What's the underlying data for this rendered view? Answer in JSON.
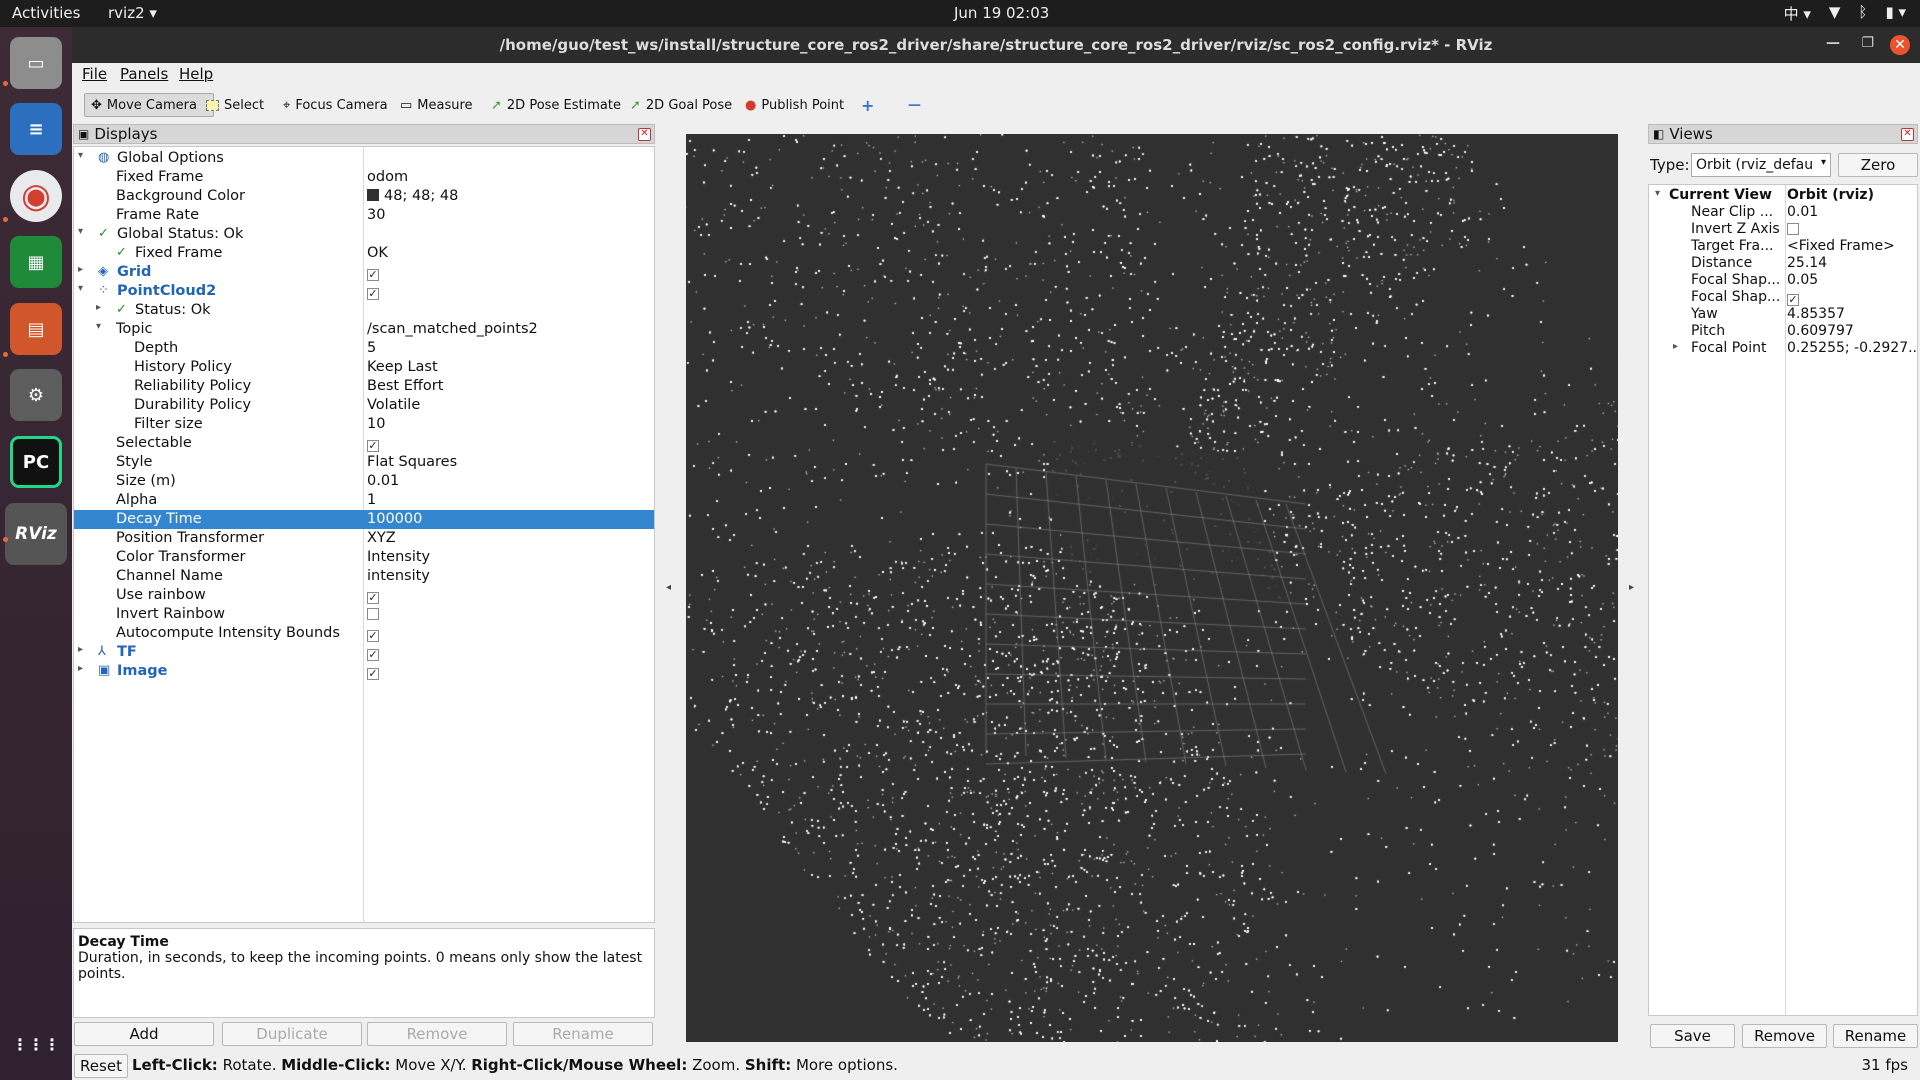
{
  "topbar": {
    "activities": "Activities",
    "app": "rviz2 ▾",
    "clock": "Jun 19  02:03",
    "lang": "中 ▾",
    "tray": [
      "▼",
      "ᛒ",
      "▮ ▾"
    ]
  },
  "dock": [
    {
      "name": "files-icon",
      "bg": "#8d8d8d",
      "glyph": "▭"
    },
    {
      "name": "writer-icon",
      "bg": "#2c6fbf",
      "glyph": "≡"
    },
    {
      "name": "chrome-icon",
      "bg": "#e8eaed",
      "glyph": "◉"
    },
    {
      "name": "calc-icon",
      "bg": "#1f8b3a",
      "glyph": "▦"
    },
    {
      "name": "impress-icon",
      "bg": "#d2562c",
      "glyph": "▤"
    },
    {
      "name": "settings-icon",
      "bg": "#5d5d5d",
      "glyph": "⚙"
    },
    {
      "name": "pycharm-icon",
      "bg": "#21d789",
      "glyph": "PC"
    },
    {
      "name": "rviz-icon",
      "bg": "#4a4a4a",
      "glyph": "RViz"
    },
    {
      "name": "apps-grid-icon",
      "bg": "transparent",
      "glyph": "⋮⋮⋮"
    }
  ],
  "window": {
    "title": "/home/guo/test_ws/install/structure_core_ros2_driver/share/structure_core_ros2_driver/rviz/sc_ros2_config.rviz* - RViz"
  },
  "menu": [
    "File",
    "Panels",
    "Help"
  ],
  "toolbar": [
    "Move Camera",
    "Select",
    "Focus Camera",
    "Measure",
    "2D Pose Estimate",
    "2D Goal Pose",
    "Publish Point",
    "+",
    "—"
  ],
  "displays": {
    "title": "Displays",
    "rows": [
      {
        "k": "Global Options",
        "v": "",
        "ind": 1,
        "arrow": "▾",
        "icon": "◍",
        "cls": ""
      },
      {
        "k": "Fixed Frame",
        "v": "odom",
        "ind": 2,
        "cls": ""
      },
      {
        "k": "Background Color",
        "v": "48; 48; 48",
        "ind": 2,
        "swatch": "#303030",
        "cls": ""
      },
      {
        "k": "Frame Rate",
        "v": "30",
        "ind": 2,
        "cls": ""
      },
      {
        "k": "Global Status: Ok",
        "v": "",
        "ind": 1,
        "arrow": "▾",
        "icon": "✓",
        "cls": "ok-icon"
      },
      {
        "k": "Fixed Frame",
        "v": "OK",
        "ind": 2,
        "icon": "✓",
        "cls": "ok-icon"
      },
      {
        "k": "Grid",
        "v": "",
        "ind": 1,
        "arrow": "▸",
        "icon": "◈",
        "cls": "blue",
        "check": true
      },
      {
        "k": "PointCloud2",
        "v": "",
        "ind": 1,
        "arrow": "▾",
        "icon": "⁘",
        "cls": "blue",
        "check": true
      },
      {
        "k": "Status: Ok",
        "v": "",
        "ind": 2,
        "arrow": "▸",
        "icon": "✓",
        "cls": "ok-icon"
      },
      {
        "k": "Topic",
        "v": "/scan_matched_points2",
        "ind": 2,
        "arrow": "▾",
        "cls": ""
      },
      {
        "k": "Depth",
        "v": "5",
        "ind": 3,
        "cls": ""
      },
      {
        "k": "History Policy",
        "v": "Keep Last",
        "ind": 3,
        "cls": ""
      },
      {
        "k": "Reliability Policy",
        "v": "Best Effort",
        "ind": 3,
        "cls": ""
      },
      {
        "k": "Durability Policy",
        "v": "Volatile",
        "ind": 3,
        "cls": ""
      },
      {
        "k": "Filter size",
        "v": "10",
        "ind": 3,
        "cls": ""
      },
      {
        "k": "Selectable",
        "v": "",
        "ind": 2,
        "check": true,
        "cls": ""
      },
      {
        "k": "Style",
        "v": "Flat Squares",
        "ind": 2,
        "cls": ""
      },
      {
        "k": "Size (m)",
        "v": "0.01",
        "ind": 2,
        "cls": ""
      },
      {
        "k": "Alpha",
        "v": "1",
        "ind": 2,
        "cls": ""
      },
      {
        "k": "Decay Time",
        "v": "100000",
        "ind": 2,
        "cls": "sel"
      },
      {
        "k": "Position Transformer",
        "v": "XYZ",
        "ind": 2,
        "cls": ""
      },
      {
        "k": "Color Transformer",
        "v": "Intensity",
        "ind": 2,
        "cls": ""
      },
      {
        "k": "Channel Name",
        "v": "intensity",
        "ind": 2,
        "cls": ""
      },
      {
        "k": "Use rainbow",
        "v": "",
        "ind": 2,
        "check": true,
        "cls": ""
      },
      {
        "k": "Invert Rainbow",
        "v": "",
        "ind": 2,
        "check": false,
        "cls": ""
      },
      {
        "k": "Autocompute Intensity Bounds",
        "v": "",
        "ind": 2,
        "check": true,
        "cls": ""
      },
      {
        "k": "TF",
        "v": "",
        "ind": 1,
        "arrow": "▸",
        "icon": "⅄",
        "cls": "blue",
        "check": true
      },
      {
        "k": "Image",
        "v": "",
        "ind": 1,
        "arrow": "▸",
        "icon": "▣",
        "cls": "blue",
        "check": true
      }
    ],
    "desc_title": "Decay Time",
    "desc_text": "Duration, in seconds, to keep the incoming points. 0 means only show the latest points.",
    "buttons": [
      "Add",
      "Duplicate",
      "Remove",
      "Rename"
    ]
  },
  "views": {
    "title": "Views",
    "type_label": "Type:",
    "type_value": "Orbit (rviz_defau",
    "zero": "Zero",
    "rows": [
      {
        "k": "Current View",
        "v": "Orbit (rviz)",
        "head": true
      },
      {
        "k": "Near Clip ...",
        "v": "0.01"
      },
      {
        "k": "Invert Z Axis",
        "v": "",
        "check": false
      },
      {
        "k": "Target Fra...",
        "v": "<Fixed Frame>"
      },
      {
        "k": "Distance",
        "v": "25.14"
      },
      {
        "k": "Focal Shap...",
        "v": "0.05"
      },
      {
        "k": "Focal Shap...",
        "v": "",
        "check": true
      },
      {
        "k": "Yaw",
        "v": "4.85357"
      },
      {
        "k": "Pitch",
        "v": "0.609797"
      },
      {
        "k": "Focal Point",
        "v": "0.25255; -0.2927...",
        "arrow": true
      }
    ],
    "buttons": [
      "Save",
      "Remove",
      "Rename"
    ]
  },
  "status": {
    "reset": "Reset",
    "help_parts": [
      [
        "Left-Click:",
        " Rotate. "
      ],
      [
        "Middle-Click:",
        " Move X/Y. "
      ],
      [
        "Right-Click/Mouse Wheel:",
        " Zoom. "
      ],
      [
        "Shift:",
        " More options."
      ]
    ],
    "fps": "31 fps"
  }
}
